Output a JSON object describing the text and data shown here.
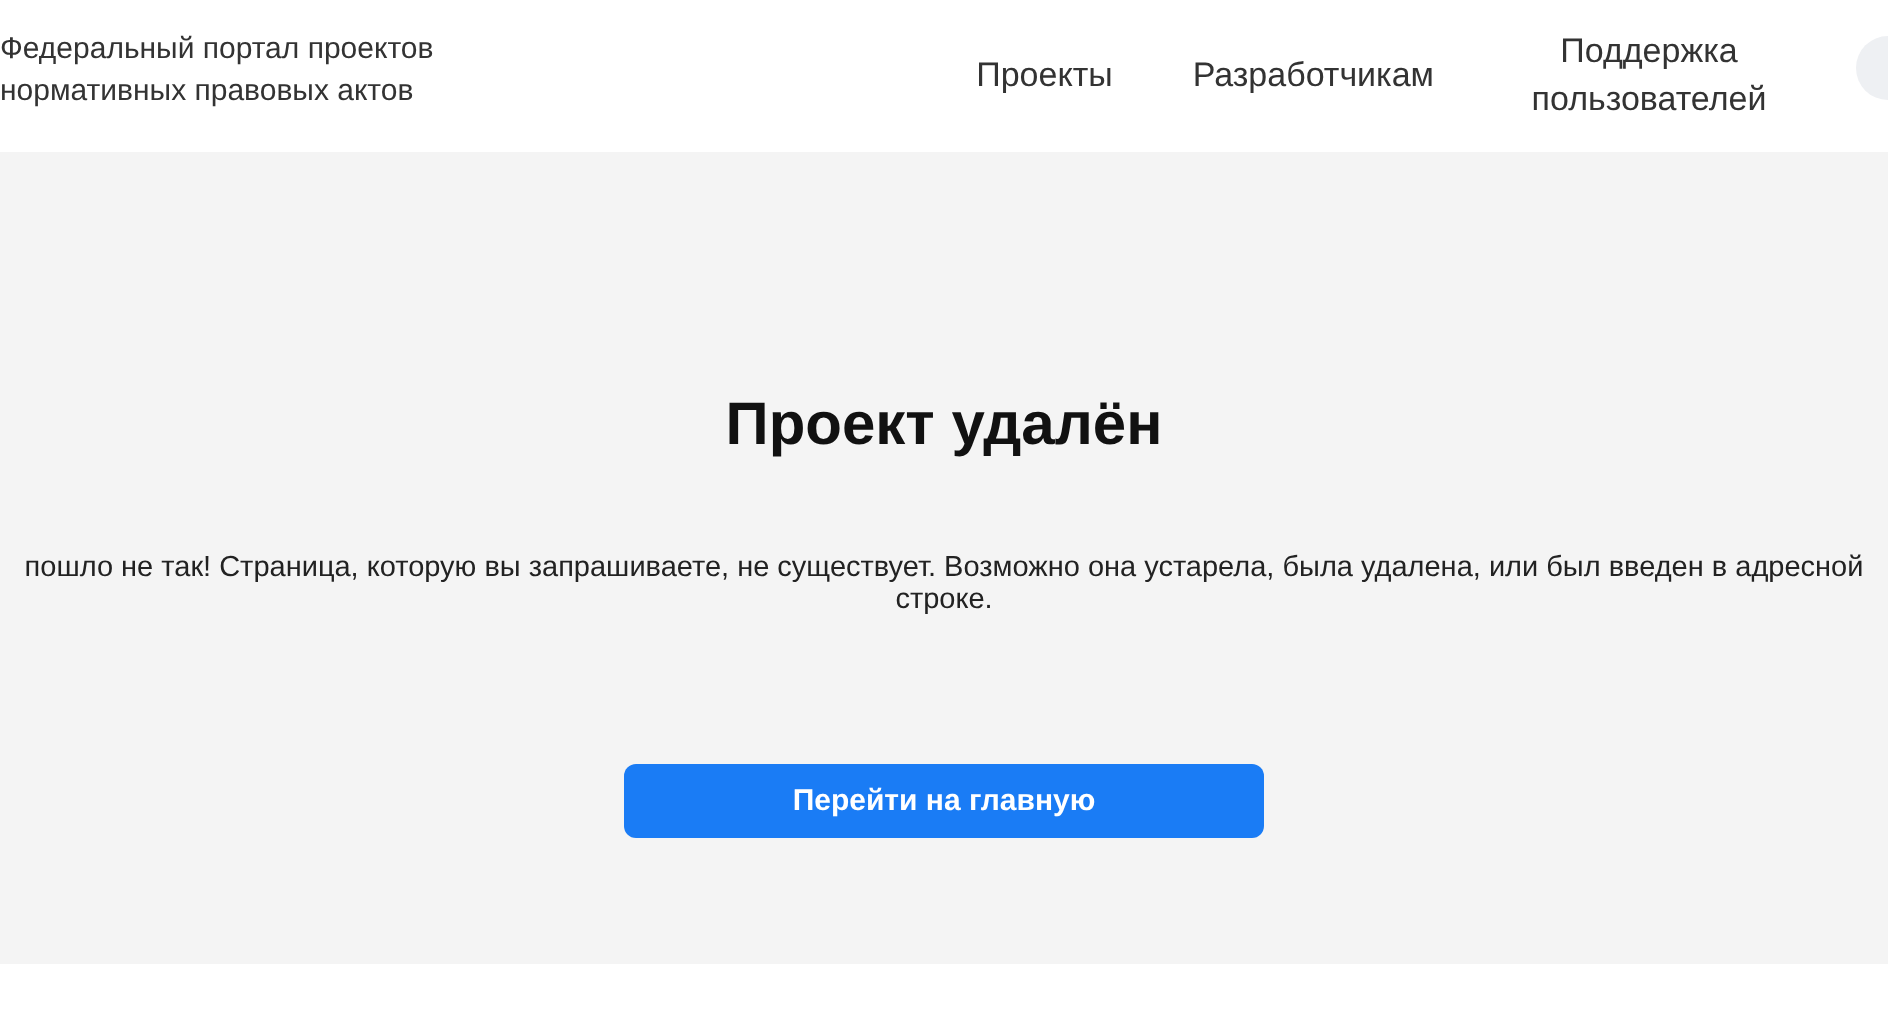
{
  "header": {
    "logo_text": [
      "Федеральный портал проектов",
      "нормативных правовых актов"
    ],
    "nav": [
      {
        "label": "Проекты"
      },
      {
        "label": "Разработчикам"
      },
      {
        "label": "Поддержка пользователей"
      }
    ]
  },
  "main": {
    "title": "Проект удалён",
    "message": "пошло не так! Страница, которую вы запрашиваете, не существует. Возможно она устарела, была удалена, или был введен в адресной строке.",
    "button": "Перейти на главную"
  }
}
